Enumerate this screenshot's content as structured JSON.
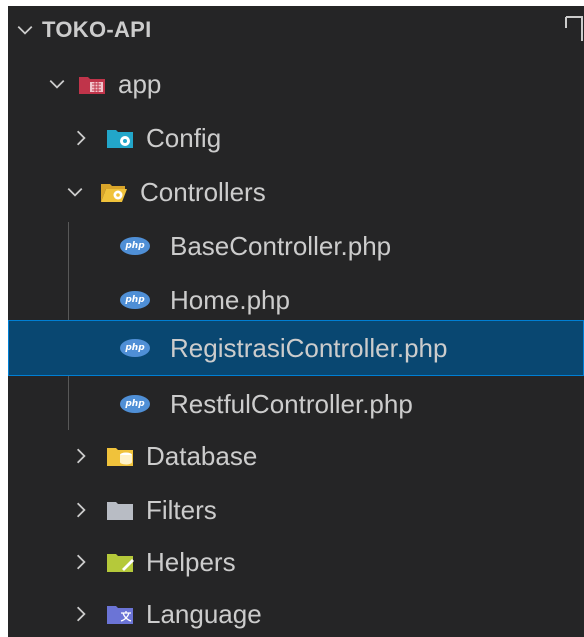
{
  "explorer": {
    "root_label": "TOKO-API",
    "app_folder": "app",
    "config_folder": "Config",
    "controllers_folder": "Controllers",
    "files": [
      "BaseController.php",
      "Home.php",
      "RegistrasiController.php",
      "RestfulController.php"
    ],
    "database_folder": "Database",
    "filters_folder": "Filters",
    "helpers_folder": "Helpers",
    "language_folder": "Language",
    "php_icon_text": "php",
    "selected_file": "RegistrasiController.php"
  },
  "colors": {
    "background": "#252526",
    "selection": "#094771",
    "selection_border": "#007fd4",
    "text": "#cccccc"
  }
}
